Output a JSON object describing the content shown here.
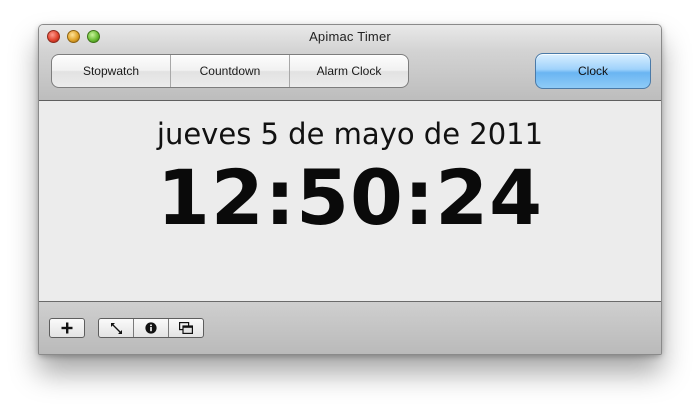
{
  "window": {
    "title": "Apimac Timer"
  },
  "modes": {
    "tabs": [
      {
        "label": "Stopwatch"
      },
      {
        "label": "Countdown"
      },
      {
        "label": "Alarm Clock"
      }
    ],
    "clock_label": "Clock"
  },
  "display": {
    "date": "jueves 5 de mayo de 2011",
    "time": "12:50:24"
  },
  "toolbar": {
    "icons": [
      "plus-icon",
      "resize-icon",
      "info-icon",
      "windows-icon"
    ]
  },
  "colors": {
    "clock_accent": "#8fcbf7",
    "content_bg": "#ececec"
  }
}
